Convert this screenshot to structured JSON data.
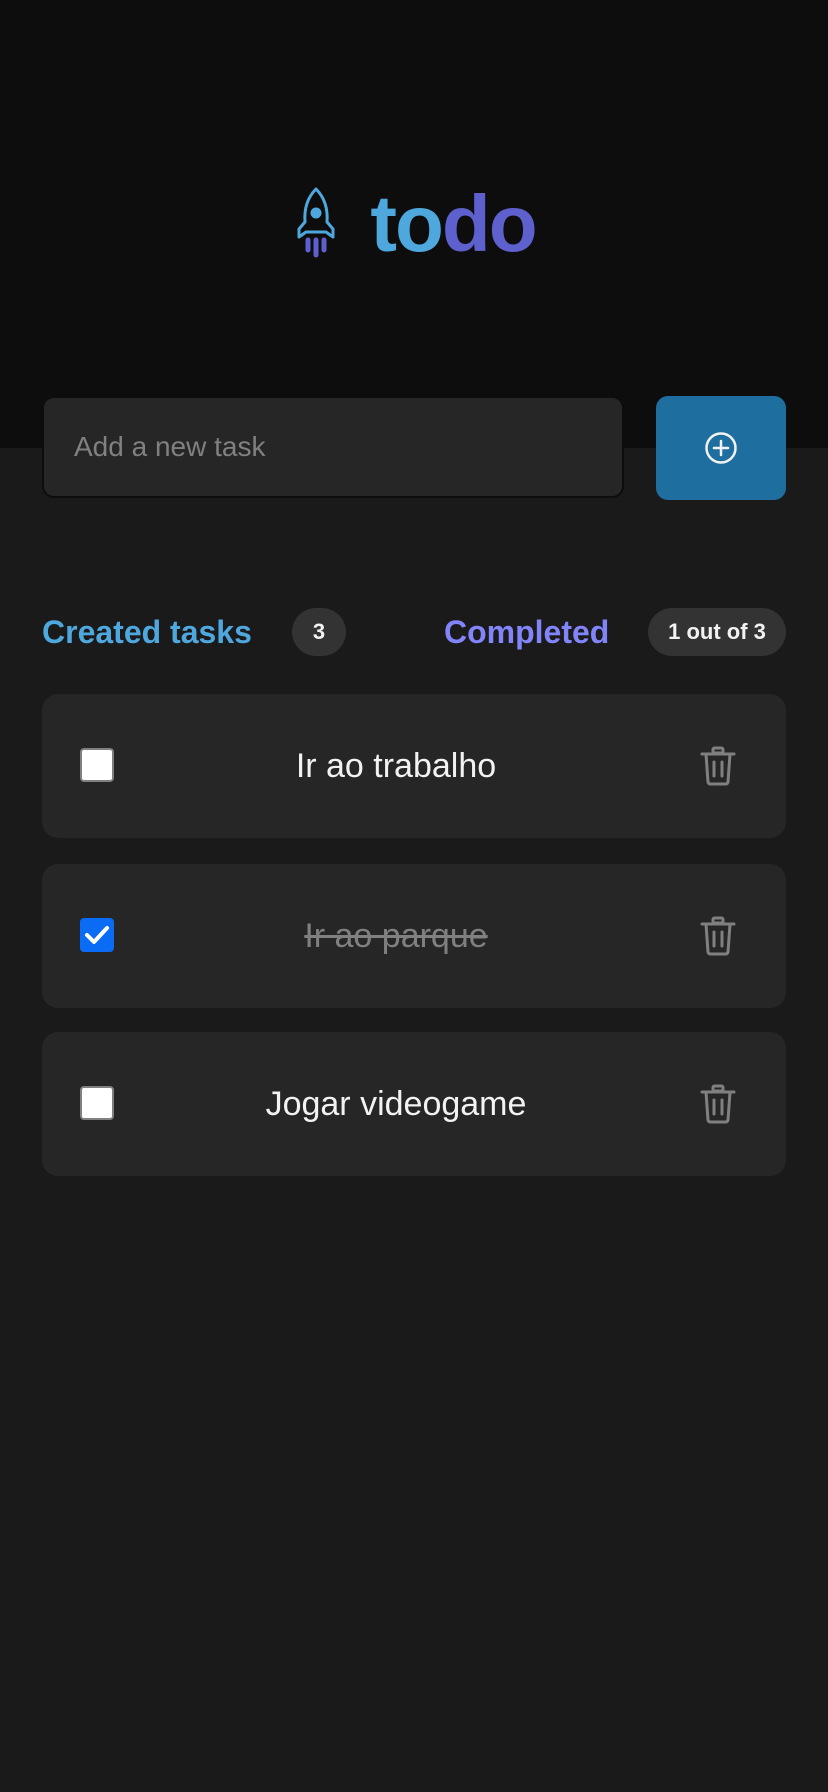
{
  "app": {
    "logo_part1": "to",
    "logo_part2": "do",
    "logo_icon": "rocket-icon"
  },
  "new_task": {
    "placeholder": "Add a new task",
    "value": "",
    "add_button_icon": "plus-circle-icon"
  },
  "stats": {
    "created_label": "Created tasks",
    "created_count": "3",
    "completed_label": "Completed",
    "completed_count": "1 out of 3"
  },
  "tasks": [
    {
      "text": "Ir ao trabalho",
      "done": false,
      "delete_icon": "trash-icon"
    },
    {
      "text": "Ir ao parque",
      "done": true,
      "delete_icon": "trash-icon"
    },
    {
      "text": "Jogar videogame",
      "done": false,
      "delete_icon": "trash-icon"
    }
  ],
  "colors": {
    "blue": "#4ea8de",
    "purple": "#5e60ce",
    "purple_light": "#8284fa",
    "button": "#1e6f9f",
    "checkbox_checked": "#0a6cf5"
  }
}
